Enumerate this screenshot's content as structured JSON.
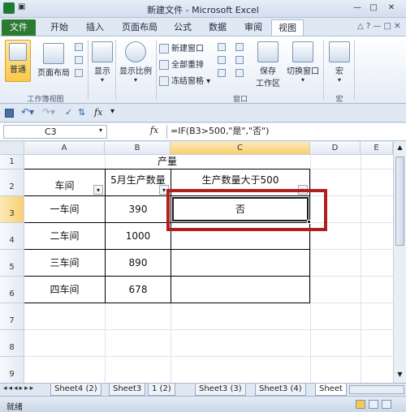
{
  "window": {
    "title": "新建文件 - Microsoft Excel",
    "minimize": "—",
    "maximize": "□",
    "close": "✕"
  },
  "tabs": [
    "文件",
    "开始",
    "插入",
    "页面布局",
    "公式",
    "数据",
    "审阅",
    "视图"
  ],
  "ribbon": {
    "groups": {
      "workbook_views": "工作簿视图",
      "window": "窗口",
      "macros": "宏"
    },
    "buttons": {
      "normal": "普通",
      "page_layout": "页面布局",
      "show": "显示",
      "zoom": "显示比例",
      "new_window": "新建窗口",
      "arrange_all": "全部重排",
      "freeze_panes": "冻结窗格",
      "save_workspace_line1": "保存",
      "save_workspace_line2": "工作区",
      "switch_windows": "切换窗口",
      "macros": "宏"
    }
  },
  "formula_bar": {
    "name_box": "C3",
    "fx": "fx",
    "formula": "=IF(B3>500,\"是\",\"否\")"
  },
  "sheet": {
    "columns": [
      "A",
      "B",
      "C",
      "D",
      "E"
    ],
    "rows": [
      "1",
      "2",
      "3",
      "4",
      "5",
      "6",
      "7",
      "8",
      "9"
    ],
    "title": "产量",
    "headers": [
      "车间",
      "5月生产数量",
      "生产数量大于500"
    ],
    "data": [
      {
        "workshop": "一车间",
        "quantity": "390",
        "result": "否"
      },
      {
        "workshop": "二车间",
        "quantity": "1000",
        "result": ""
      },
      {
        "workshop": "三车间",
        "quantity": "890",
        "result": ""
      },
      {
        "workshop": "四车间",
        "quantity": "678",
        "result": ""
      }
    ]
  },
  "sheet_tabs": [
    "Sheet4 (2)",
    "Sheet3",
    "1 (2)",
    "Sheet3 (3)",
    "Sheet3 (4)",
    "Sheet"
  ],
  "status": {
    "ready": "就绪"
  },
  "colors": {
    "file_tab": "#2b7b32",
    "highlight": "#b11e1e",
    "selected_header": "#f8cf72"
  }
}
